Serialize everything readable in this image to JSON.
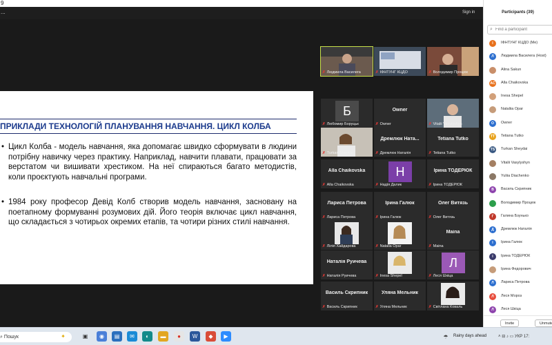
{
  "window": {
    "title": "9"
  },
  "zoom": {
    "menu_dots": "...",
    "sign_in": "Sign in"
  },
  "slide": {
    "heading": "ПРИКЛАДИ ТЕХНОЛОГІЙ ПЛАНУВАННЯ НАВЧАННЯ. ЦИКЛ КОЛБА",
    "bullets": [
      "Цикл Колба - модель навчання, яка допомагає швидко сформувати в людини потрібну навичку через практику. Наприклад, навчити плавати, працювати за верстатом чи вишивати хрестиком. На неї спираються багато методистів, коли проєктують навчальні програми.",
      "1984 року професор Девід Колб створив модель навчання, засновану на поетапному формуванні розумових дій. Його теорія включає цикл навчання, що складається з чотирьох окремих етапів, та чотири різних стилі навчання."
    ]
  },
  "tiles": [
    {
      "caption": "Людмила Василега",
      "label": "",
      "initial": ""
    },
    {
      "caption": "ІФНТУНГ КЦДО",
      "label": "",
      "initial": ""
    },
    {
      "caption": "Володимир Процюк",
      "label": "",
      "initial": ""
    },
    {
      "caption": "Любомир Боруцьк",
      "label": "",
      "initial": "Б"
    },
    {
      "caption": "Owner",
      "label": "Owner",
      "initial": ""
    },
    {
      "caption": "Vitalii Vasylyshyn",
      "label": "",
      "initial": ""
    },
    {
      "caption": "Turkan Sheyda",
      "label": "",
      "initial": ""
    },
    {
      "caption": "Дремлюк Наталія",
      "label": "Дремлюк Ната...",
      "initial": ""
    },
    {
      "caption": "Tetiana Tutko",
      "label": "Tetiana Tutko",
      "initial": ""
    },
    {
      "caption": "Alla Chaikovska",
      "label": "Alla Chaikovska",
      "initial": ""
    },
    {
      "caption": "Надія Далик",
      "label": "",
      "initial": "Н"
    },
    {
      "caption": "Ірина ТОДЕРЮК",
      "label": "Ірина ТОДЕРЮК",
      "initial": ""
    },
    {
      "caption": "Лариса Петрова",
      "label": "Лариса Петрова",
      "initial": ""
    },
    {
      "caption": "Ірина Галюк",
      "label": "Ірина Галюк",
      "initial": ""
    },
    {
      "caption": "Олег Витязь",
      "label": "Олег Витязь",
      "initial": ""
    },
    {
      "caption": "Лілія Хайдарова",
      "label": "",
      "initial": ""
    },
    {
      "caption": "Natalia Opar",
      "label": "",
      "initial": ""
    },
    {
      "caption": "Maina",
      "label": "Maina",
      "initial": ""
    },
    {
      "caption": "Наталія Руичева",
      "label": "Наталія Руичева",
      "initial": ""
    },
    {
      "caption": "Inesa Shepel",
      "label": "",
      "initial": ""
    },
    {
      "caption": "Леся Шкіца",
      "label": "",
      "initial": "Л"
    },
    {
      "caption": "Василь Скрипник",
      "label": "Василь Скрипник",
      "initial": ""
    },
    {
      "caption": "Уляна Мельник",
      "label": "Уляна Мельник",
      "initial": ""
    },
    {
      "caption": "Світлана Коваль",
      "label": "",
      "initial": ""
    }
  ],
  "participants": {
    "title": "Participants (39)",
    "search_placeholder": "Find a participant",
    "list": [
      {
        "name": "ІФНТУНГ КЦДО (Me)",
        "initial": "І",
        "color": "#e8711c"
      },
      {
        "name": "Людмила Василега (Host)",
        "initial": "Л",
        "color": "#2d6fcf"
      },
      {
        "name": "Alina Sakun",
        "initial": "",
        "color": "#c98f6a"
      },
      {
        "name": "Alla Chaikovska",
        "initial": "AC",
        "color": "#e8711c"
      },
      {
        "name": "Inesa Shepel",
        "initial": "",
        "color": "#d2a07a"
      },
      {
        "name": "Nataliia Opar",
        "initial": "",
        "color": "#c69c7a"
      },
      {
        "name": "Owner",
        "initial": "O",
        "color": "#2d6fcf"
      },
      {
        "name": "Tetiana Tutko",
        "initial": "TT",
        "color": "#e8a21c"
      },
      {
        "name": "Turkan Sheydai",
        "initial": "TS",
        "color": "#3b5a83"
      },
      {
        "name": "Vitalii Vasylyshyn",
        "initial": "",
        "color": "#a47f62"
      },
      {
        "name": "Yuliia Diachenko",
        "initial": "",
        "color": "#8b7866"
      },
      {
        "name": "Василь Скрипник",
        "initial": "В",
        "color": "#8e44ad"
      },
      {
        "name": "Володимир Процюк",
        "initial": "",
        "color": "#2c9e4b"
      },
      {
        "name": "Галина Бзунько",
        "initial": "Г",
        "color": "#c0392b"
      },
      {
        "name": "Дремлюк Наталія",
        "initial": "Д",
        "color": "#2d6fcf"
      },
      {
        "name": "Ірина Галюк",
        "initial": "І",
        "color": "#2d6fcf"
      },
      {
        "name": "Ірина ТОДЕРЮК",
        "initial": "І",
        "color": "#3b3b6b"
      },
      {
        "name": "Ірина Федорович",
        "initial": "",
        "color": "#c69c7a"
      },
      {
        "name": "Лариса Петрова",
        "initial": "Л",
        "color": "#2d6fcf"
      },
      {
        "name": "Леся Мороз",
        "initial": "Л",
        "color": "#e74c3c"
      },
      {
        "name": "Леся Шкіца",
        "initial": "Л",
        "color": "#8e44ad"
      }
    ],
    "invite_label": "Invite",
    "unmute_label": "Unmute"
  },
  "taskbar": {
    "search_text": "Пошук",
    "weather": "Rainy days ahead",
    "lang": "УКР",
    "time": "17:"
  }
}
